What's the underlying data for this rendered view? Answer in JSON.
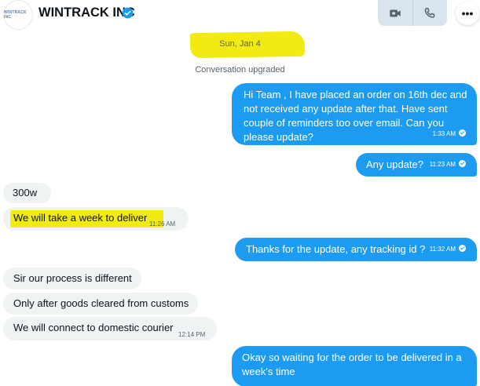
{
  "header": {
    "avatar_text": "WINTRACK INC",
    "company_name": "WINTRACK INC",
    "verified_icon": "verified-badge-icon",
    "actions": [
      {
        "name": "video-call",
        "icon": "video-camera-icon"
      },
      {
        "name": "voice-call",
        "icon": "phone-icon"
      }
    ],
    "more_icon": "more-options-icon",
    "more_label": "•••"
  },
  "conversation": {
    "date_label": "Sun, Jan 4",
    "system_message": "Conversation upgraded"
  },
  "messages": [
    {
      "direction": "outgoing",
      "text": "Hi Team , I have placed an order on 16th dec and not received any update after that. Have sent couple of reminders too over email. Can you please update?",
      "time": "1:33 AM"
    },
    {
      "direction": "outgoing",
      "text": "Any update?",
      "time": "11:23 AM"
    },
    {
      "direction": "incoming",
      "text": "300w",
      "time": ""
    },
    {
      "direction": "incoming",
      "text": "We will take a week to deliver",
      "time": "11:26 AM"
    },
    {
      "direction": "outgoing",
      "text": "Thanks for the update, any tracking id ?",
      "time": "11:32 AM"
    },
    {
      "direction": "incoming",
      "text": "Sir our process is different",
      "time": ""
    },
    {
      "direction": "incoming",
      "text": "Only after goods cleared from customs",
      "time": ""
    },
    {
      "direction": "incoming",
      "text": "We will connect to domestic courier",
      "time": "12:14 PM"
    },
    {
      "direction": "outgoing",
      "text": "Okay so waiting for the order to be delivered in a week's time",
      "time": ""
    }
  ],
  "colors": {
    "outgoing_bubble": "#1d9bf0",
    "incoming_bubble": "#eff3f4",
    "highlight": "#f2ea10",
    "verified": "#1d9bf0"
  }
}
